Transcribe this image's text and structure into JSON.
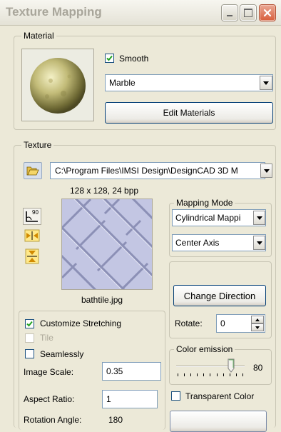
{
  "window": {
    "title": "Texture Mapping"
  },
  "material": {
    "legend": "Material",
    "smooth_label": "Smooth",
    "smooth_checked": true,
    "material_value": "Marble",
    "edit_button": "Edit Materials"
  },
  "texture": {
    "legend": "Texture",
    "path_value": "C:\\Program Files\\IMSI Design\\DesignCAD 3D M",
    "image_info": "128 x 128, 24 bpp",
    "file_name": "bathtile.jpg",
    "rotate_90_label": "90"
  },
  "mapping": {
    "legend": "Mapping Mode",
    "mode_value": "Cylindrical Mappi",
    "axis_value": "Center Axis",
    "change_direction_button": "Change Direction",
    "rotate_label": "Rotate:",
    "rotate_value": "0"
  },
  "stretching": {
    "customize_label": "Customize Stretching",
    "customize_checked": true,
    "tile_label": "Tile",
    "seamlessly_label": "Seamlessly",
    "image_scale_label": "Image Scale:",
    "image_scale_value": "0.35",
    "aspect_ratio_label": "Aspect Ratio:",
    "aspect_ratio_value": "1",
    "rotation_angle_label": "Rotation Angle:",
    "rotation_angle_value": "180"
  },
  "emission": {
    "legend": "Color emission",
    "value": "80",
    "level_fraction": 0.8,
    "transparent_label": "Transparent Color"
  },
  "colors": {
    "title_text": "#a8a59a",
    "close_button": "#d9613f",
    "window_bg": "#ece9d8"
  }
}
